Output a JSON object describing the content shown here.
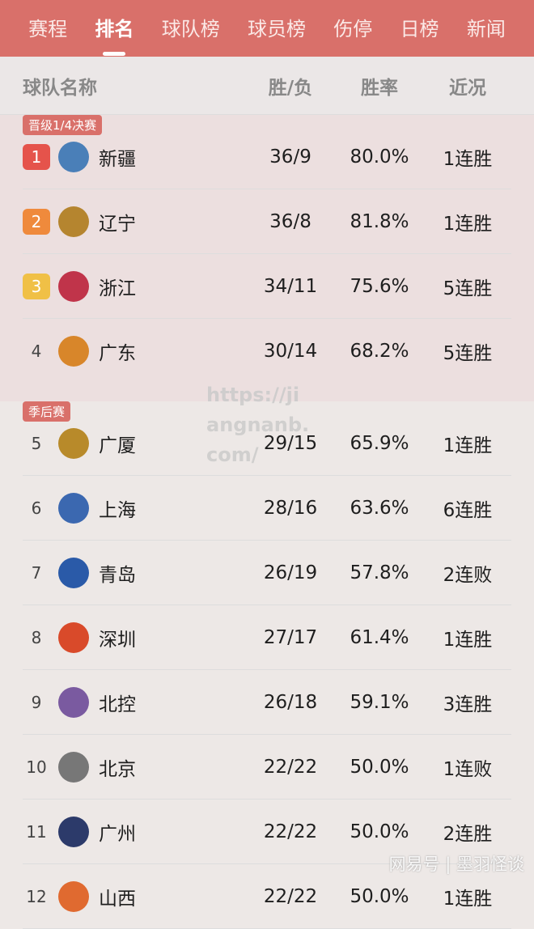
{
  "tabs": [
    {
      "label": "赛程"
    },
    {
      "label": "排名",
      "active": true
    },
    {
      "label": "球队榜"
    },
    {
      "label": "球员榜"
    },
    {
      "label": "伤停"
    },
    {
      "label": "日榜"
    },
    {
      "label": "新闻"
    }
  ],
  "columns": {
    "name": "球队名称",
    "wl": "胜/负",
    "pct": "胜率",
    "recent": "近况"
  },
  "colors": {
    "accent": "#d9706a",
    "rank1": "#e5534b",
    "rank2": "#ef8a3c",
    "rank3": "#f0c046"
  },
  "sections": [
    {
      "label": "晋级1/4决赛",
      "rows": [
        {
          "rank": "1",
          "team": "新疆",
          "wl": "36/9",
          "pct": "80.0%",
          "recent": "1连胜",
          "logo": "#4a7fb8"
        },
        {
          "rank": "2",
          "team": "辽宁",
          "wl": "36/8",
          "pct": "81.8%",
          "recent": "1连胜",
          "logo": "#b5852f"
        },
        {
          "rank": "3",
          "team": "浙江",
          "wl": "34/11",
          "pct": "75.6%",
          "recent": "5连胜",
          "logo": "#c0344a"
        },
        {
          "rank": "4",
          "team": "广东",
          "wl": "30/14",
          "pct": "68.2%",
          "recent": "5连胜",
          "logo": "#d8862a"
        }
      ]
    },
    {
      "label": "季后赛",
      "rows": [
        {
          "rank": "5",
          "team": "广厦",
          "wl": "29/15",
          "pct": "65.9%",
          "recent": "1连胜",
          "logo": "#b88a2a"
        },
        {
          "rank": "6",
          "team": "上海",
          "wl": "28/16",
          "pct": "63.6%",
          "recent": "6连胜",
          "logo": "#3b68b0"
        },
        {
          "rank": "7",
          "team": "青岛",
          "wl": "26/19",
          "pct": "57.8%",
          "recent": "2连败",
          "logo": "#2a5aa8"
        },
        {
          "rank": "8",
          "team": "深圳",
          "wl": "27/17",
          "pct": "61.4%",
          "recent": "1连胜",
          "logo": "#d94a2a"
        },
        {
          "rank": "9",
          "team": "北控",
          "wl": "26/18",
          "pct": "59.1%",
          "recent": "3连胜",
          "logo": "#7a5aa0"
        },
        {
          "rank": "10",
          "team": "北京",
          "wl": "22/22",
          "pct": "50.0%",
          "recent": "1连败",
          "logo": "#777777"
        },
        {
          "rank": "11",
          "team": "广州",
          "wl": "22/22",
          "pct": "50.0%",
          "recent": "2连胜",
          "logo": "#2c3a6a"
        },
        {
          "rank": "12",
          "team": "山西",
          "wl": "22/22",
          "pct": "50.0%",
          "recent": "1连胜",
          "logo": "#e06a30"
        }
      ]
    }
  ],
  "watermark": "https://jiangnanb.com/",
  "watermark2": "网易号 | 墨羽怪谈"
}
